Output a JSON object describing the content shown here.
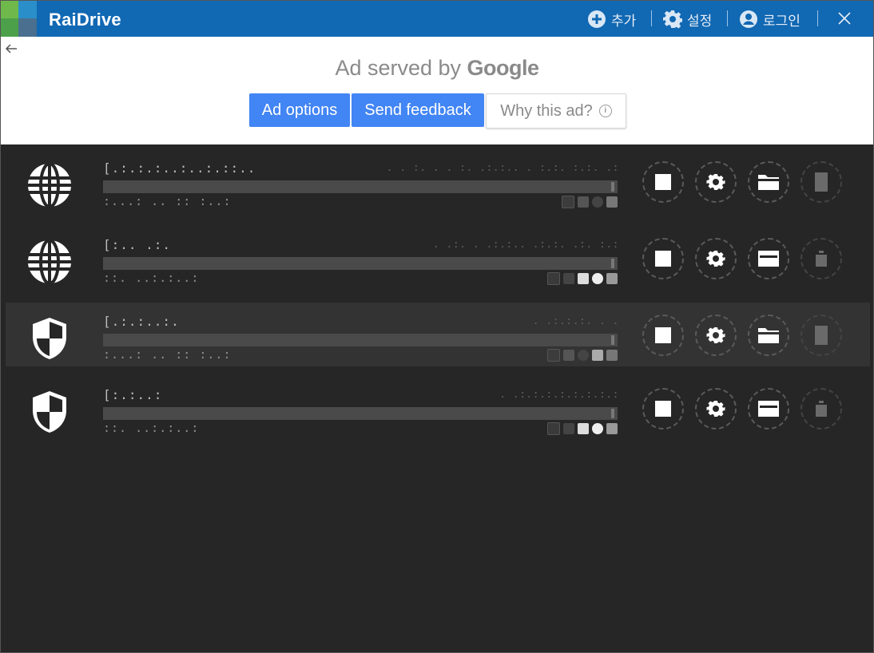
{
  "app": {
    "title": "RaiDrive",
    "actions": {
      "add_label": "추가",
      "settings_label": "설정",
      "login_label": "로그인"
    },
    "brand_color": "#1168b3"
  },
  "ad": {
    "served_by": "Ad served by",
    "brand": "Google",
    "buttons": {
      "options": "Ad options",
      "feedback": "Send feedback",
      "why": "Why this ad?"
    },
    "info_glyph": "i"
  },
  "drives": [
    {
      "icon": "globe-icon",
      "name": "[.:.:.:..:..:.::..",
      "path": ". . :. . . :. .:.:.. . :.:. :.:. .:",
      "status": ":...: .. :: :..:",
      "fill": 1.0,
      "connected": false
    },
    {
      "icon": "globe-icon",
      "name": "[:.. .:.",
      "path": ". .:. . .:.:.. .:.:. .:. :.:",
      "status": "::. ..:.:..:",
      "fill": 1.0,
      "connected": true
    },
    {
      "icon": "shield-icon",
      "name": "[.:.:..:.",
      "path": ". .:.:.:. . .",
      "status": ":...: .. :: :..:",
      "fill": 1.0,
      "connected": false
    },
    {
      "icon": "shield-icon",
      "name": "[:.:..:",
      "path": ". .:.:.:.:.:.:.:.:",
      "status": "::. ..:.:..:",
      "fill": 1.0,
      "connected": true
    }
  ]
}
